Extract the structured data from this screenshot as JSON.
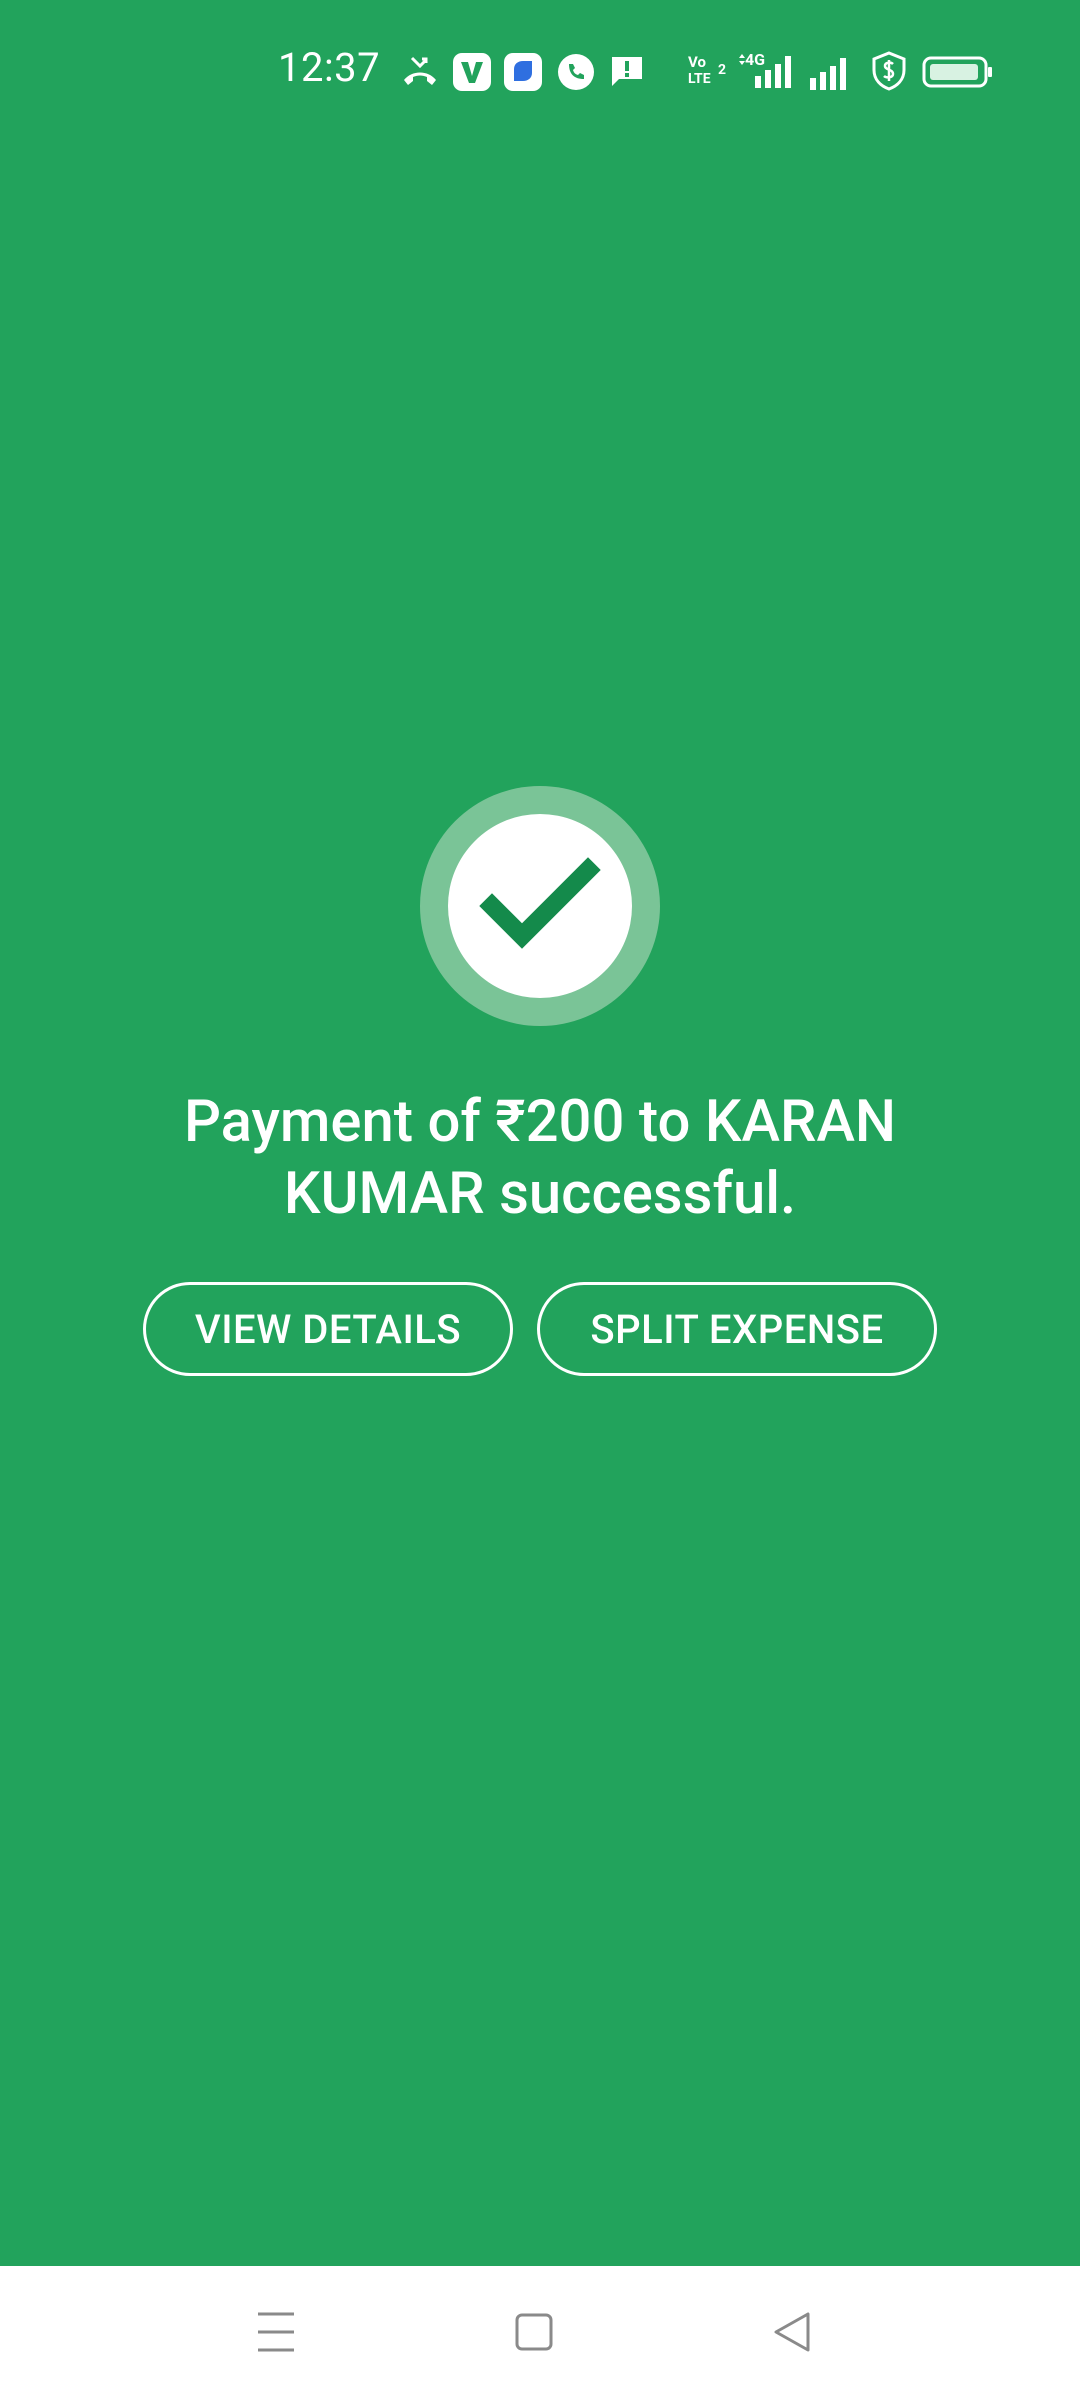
{
  "status_bar": {
    "time": "12:37",
    "icons": [
      "missed-call-icon",
      "vi-app-icon",
      "files-app-icon",
      "whatsapp-icon",
      "message-alert-icon",
      "volte-icon",
      "4g-signal-icon",
      "signal-icon",
      "shield-dollar-icon",
      "battery-icon"
    ],
    "volte_line1": "Vo",
    "volte_line2": "LTE",
    "sim_badge": "2",
    "network_label": "4G"
  },
  "result": {
    "status_icon": "check-icon",
    "message": "Payment of ₹200 to KARAN KUMAR successful."
  },
  "actions": {
    "view_details": "VIEW DETAILS",
    "split_expense": "SPLIT EXPENSE"
  },
  "nav_bar": {
    "icons": [
      "menu-icon",
      "home-icon",
      "back-icon"
    ]
  },
  "colors": {
    "background": "#22a35c",
    "ring": "#7ac497",
    "check": "#148a4b",
    "nav_bar": "#ffffff"
  }
}
